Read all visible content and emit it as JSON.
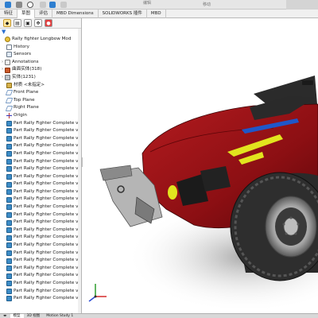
{
  "toolbar": {
    "label_a": "编辑",
    "label_b": "移动",
    "accent": "#2a6fd1"
  },
  "tabs": [
    {
      "label": "特征"
    },
    {
      "label": "草图"
    },
    {
      "label": "评估"
    },
    {
      "label": "MBD Dimensions"
    },
    {
      "label": "SOLIDWORKS 插件"
    },
    {
      "label": "MBD"
    }
  ],
  "panel": {
    "filter_icon": "filter-icon",
    "root": "Rally fighter Longbow Mod",
    "history": "History",
    "sensors": "Sensors",
    "annotations": "Annotations",
    "surface_bodies": "曲面实体(318)",
    "solid_bodies": "实体(1231)",
    "material": "材质 <未指定>",
    "front_plane": "Front Plane",
    "top_plane": "Top Plane",
    "right_plane": "Right Plane",
    "origin": "Origin",
    "parts": [
      "Part Rally Fighter Complete v2",
      "Part Rally Fighter Complete v2",
      "Part Rally Fighter Complete v2",
      "Part Rally Fighter Complete v2",
      "Part Rally Fighter Complete v2",
      "Part Rally Fighter Complete v2",
      "Part Rally Fighter Complete v2",
      "Part Rally Fighter Complete v2",
      "Part Rally Fighter Complete v2",
      "Part Rally Fighter Complete v2",
      "Part Rally Fighter Complete v2",
      "Part Rally Fighter Complete v2",
      "Part Rally Fighter Complete v2",
      "Part Rally Fighter Complete v2",
      "Part Rally Fighter Complete v2",
      "Part Rally Fighter Complete v2",
      "Part Rally Fighter Complete v2",
      "Part Rally Fighter Complete v2",
      "Part Rally Fighter Complete v2",
      "Part Rally Fighter Complete v2",
      "Part Rally Fighter Complete v2",
      "Part Rally Fighter Complete v2",
      "Part Rally Fighter Complete v2",
      "Part Rally Fighter Complete v2"
    ]
  },
  "bottom_tabs": [
    {
      "label": "模型"
    },
    {
      "label": "3D 视图"
    },
    {
      "label": "Motion Study 1"
    }
  ],
  "colors": {
    "body_red": "#9e1418",
    "stripe_yellow": "#e2e41e",
    "stripe_blue": "#1f57c9"
  }
}
